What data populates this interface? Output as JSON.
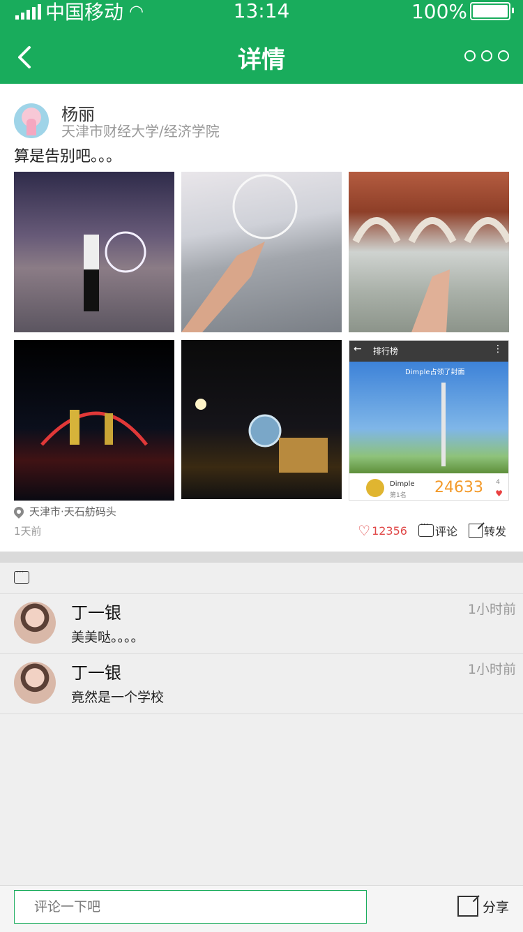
{
  "status_bar": {
    "carrier": "中国移动",
    "time": "13:14",
    "battery": "100%"
  },
  "nav": {
    "title": "详情",
    "back_icon": "chevron-left-icon",
    "more_icon": "more-horizontal-icon"
  },
  "post": {
    "author": "杨丽",
    "school": "天津市财经大学/经济学院",
    "content": "算是告别吧。。。",
    "photos": [
      "night-ferris-wheel",
      "hand-ferris-wheel",
      "campus-arches",
      "lit-bridge-night",
      "clock-tower-night",
      "app-screenshot-tower"
    ],
    "embedded_app": {
      "title": "排行榜",
      "banner": "Dimple占领了封面",
      "user": "Dimple",
      "rank": "第1名",
      "score": "24633",
      "likes": "4"
    },
    "location": "天津市·天石舫码头",
    "time_ago": "1天前",
    "likes": "12356",
    "comment_label": "评论",
    "forward_label": "转发"
  },
  "comments": [
    {
      "name": "丁一银",
      "time": "1小时前",
      "text": "美美哒。。。。"
    },
    {
      "name": "丁一银",
      "time": "1小时前",
      "text": "竟然是一个学校"
    }
  ],
  "bottom_bar": {
    "placeholder": "评论一下吧",
    "share_label": "分享"
  },
  "colors": {
    "brand_green": "#19ac5c",
    "like_red": "#e04848",
    "score_orange": "#f39a2a"
  }
}
